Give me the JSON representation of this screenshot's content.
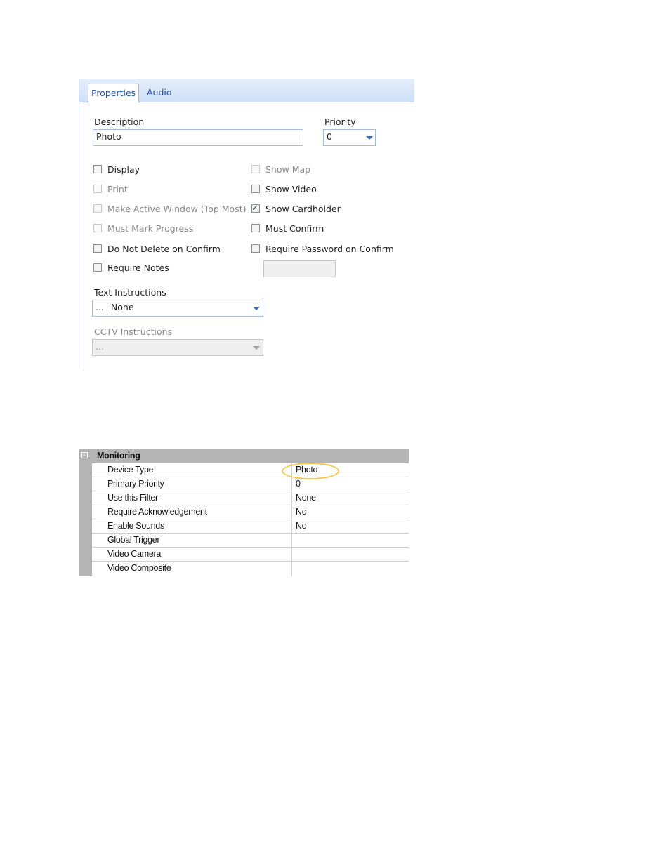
{
  "properties_panel": {
    "tabs": [
      {
        "label": "Properties",
        "active": true
      },
      {
        "label": "Audio",
        "active": false
      }
    ],
    "description": {
      "label": "Description",
      "value": "Photo"
    },
    "priority": {
      "label": "Priority",
      "value": "0"
    },
    "checkboxes": [
      {
        "label": "Display",
        "checked": false,
        "enabled": true
      },
      {
        "label": "Print",
        "checked": false,
        "enabled": false
      },
      {
        "label": "Make Active Window (Top Most)",
        "checked": false,
        "enabled": false
      },
      {
        "label": "Must Mark Progress",
        "checked": false,
        "enabled": false
      },
      {
        "label": "Do Not Delete on Confirm",
        "checked": false,
        "enabled": true
      },
      {
        "label": "Require Notes",
        "checked": false,
        "enabled": true
      },
      {
        "label": "Show Map",
        "checked": false,
        "enabled": false
      },
      {
        "label": "Show Video",
        "checked": false,
        "enabled": true
      },
      {
        "label": "Show Cardholder",
        "checked": true,
        "enabled": true
      },
      {
        "label": "Must Confirm",
        "checked": false,
        "enabled": true
      },
      {
        "label": "Require Password on Confirm",
        "checked": false,
        "enabled": true
      }
    ],
    "password_field": {
      "value": ""
    },
    "text_instructions": {
      "label": "Text Instructions",
      "ellipsis": "...",
      "value": "None"
    },
    "cctv_instructions": {
      "label": "CCTV Instructions",
      "value": "..."
    }
  },
  "monitoring_grid": {
    "category": "Monitoring",
    "collapse_glyph": "−",
    "rows": [
      {
        "name": "Device Type",
        "value": "Photo"
      },
      {
        "name": "Primary Priority",
        "value": "0"
      },
      {
        "name": "Use this Filter",
        "value": "None"
      },
      {
        "name": "Require Acknowledgement",
        "value": "No"
      },
      {
        "name": "Enable Sounds",
        "value": "No"
      },
      {
        "name": "Global Trigger",
        "value": ""
      },
      {
        "name": "Video Camera",
        "value": ""
      },
      {
        "name": "Video Composite",
        "value": ""
      }
    ],
    "highlight_color": "#f2c94c"
  }
}
